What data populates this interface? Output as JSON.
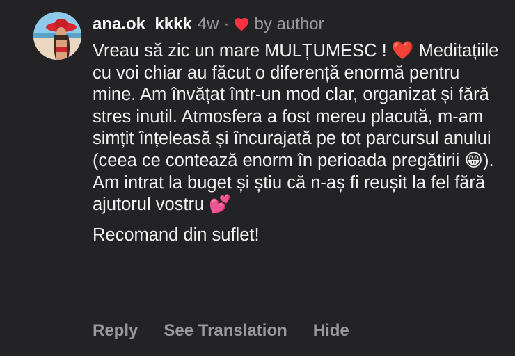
{
  "comment": {
    "username": "ana.ok_kkkk",
    "age": "4w",
    "separator": "·",
    "liked_by": "by author",
    "text_part1": "Vreau să zic un mare MULȚUMESC ! ❤️ Meditațiile cu voi chiar au făcut o diferență enormă pentru mine. Am învățat într-un mod clar, organizat și fără stres inutil. Atmosfera a fost mereu placută, m-am simțit înțeleasă și încurajată pe tot parcursul anului (ceea ce contează enorm în perioada pregătirii ",
    "emoji_grin": "😁",
    "text_part2": "). Am intrat la buget și știu că n-aș fi reușit la fel fără ajutorul vostru ",
    "emoji_hearts": "💕",
    "text_line_last": "Recomand din suflet!"
  },
  "actions": {
    "reply": "Reply",
    "see_translation": "See Translation",
    "hide": "Hide"
  },
  "icons": {
    "heart": "heart-icon",
    "heart_color": "#ff3040"
  },
  "colors": {
    "background": "#232325",
    "text": "#f2f2f2",
    "muted": "#9a9a9e"
  }
}
